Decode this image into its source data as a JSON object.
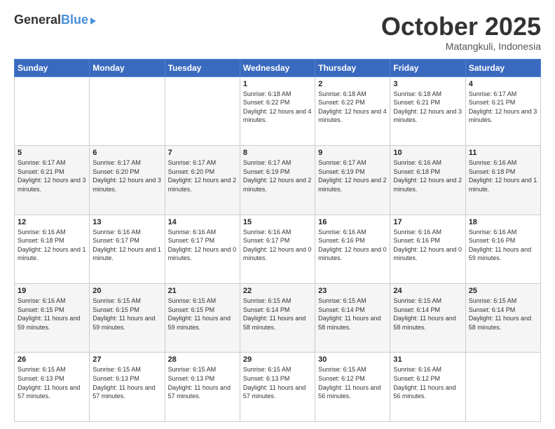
{
  "logo": {
    "general": "General",
    "blue": "Blue"
  },
  "header": {
    "month": "October 2025",
    "location": "Matangkuli, Indonesia"
  },
  "days_of_week": [
    "Sunday",
    "Monday",
    "Tuesday",
    "Wednesday",
    "Thursday",
    "Friday",
    "Saturday"
  ],
  "weeks": [
    [
      {
        "day": "",
        "sunrise": "",
        "sunset": "",
        "daylight": ""
      },
      {
        "day": "",
        "sunrise": "",
        "sunset": "",
        "daylight": ""
      },
      {
        "day": "",
        "sunrise": "",
        "sunset": "",
        "daylight": ""
      },
      {
        "day": "1",
        "sunrise": "Sunrise: 6:18 AM",
        "sunset": "Sunset: 6:22 PM",
        "daylight": "Daylight: 12 hours and 4 minutes."
      },
      {
        "day": "2",
        "sunrise": "Sunrise: 6:18 AM",
        "sunset": "Sunset: 6:22 PM",
        "daylight": "Daylight: 12 hours and 4 minutes."
      },
      {
        "day": "3",
        "sunrise": "Sunrise: 6:18 AM",
        "sunset": "Sunset: 6:21 PM",
        "daylight": "Daylight: 12 hours and 3 minutes."
      },
      {
        "day": "4",
        "sunrise": "Sunrise: 6:17 AM",
        "sunset": "Sunset: 6:21 PM",
        "daylight": "Daylight: 12 hours and 3 minutes."
      }
    ],
    [
      {
        "day": "5",
        "sunrise": "Sunrise: 6:17 AM",
        "sunset": "Sunset: 6:21 PM",
        "daylight": "Daylight: 12 hours and 3 minutes."
      },
      {
        "day": "6",
        "sunrise": "Sunrise: 6:17 AM",
        "sunset": "Sunset: 6:20 PM",
        "daylight": "Daylight: 12 hours and 3 minutes."
      },
      {
        "day": "7",
        "sunrise": "Sunrise: 6:17 AM",
        "sunset": "Sunset: 6:20 PM",
        "daylight": "Daylight: 12 hours and 2 minutes."
      },
      {
        "day": "8",
        "sunrise": "Sunrise: 6:17 AM",
        "sunset": "Sunset: 6:19 PM",
        "daylight": "Daylight: 12 hours and 2 minutes."
      },
      {
        "day": "9",
        "sunrise": "Sunrise: 6:17 AM",
        "sunset": "Sunset: 6:19 PM",
        "daylight": "Daylight: 12 hours and 2 minutes."
      },
      {
        "day": "10",
        "sunrise": "Sunrise: 6:16 AM",
        "sunset": "Sunset: 6:18 PM",
        "daylight": "Daylight: 12 hours and 2 minutes."
      },
      {
        "day": "11",
        "sunrise": "Sunrise: 6:16 AM",
        "sunset": "Sunset: 6:18 PM",
        "daylight": "Daylight: 12 hours and 1 minute."
      }
    ],
    [
      {
        "day": "12",
        "sunrise": "Sunrise: 6:16 AM",
        "sunset": "Sunset: 6:18 PM",
        "daylight": "Daylight: 12 hours and 1 minute."
      },
      {
        "day": "13",
        "sunrise": "Sunrise: 6:16 AM",
        "sunset": "Sunset: 6:17 PM",
        "daylight": "Daylight: 12 hours and 1 minute."
      },
      {
        "day": "14",
        "sunrise": "Sunrise: 6:16 AM",
        "sunset": "Sunset: 6:17 PM",
        "daylight": "Daylight: 12 hours and 0 minutes."
      },
      {
        "day": "15",
        "sunrise": "Sunrise: 6:16 AM",
        "sunset": "Sunset: 6:17 PM",
        "daylight": "Daylight: 12 hours and 0 minutes."
      },
      {
        "day": "16",
        "sunrise": "Sunrise: 6:16 AM",
        "sunset": "Sunset: 6:16 PM",
        "daylight": "Daylight: 12 hours and 0 minutes."
      },
      {
        "day": "17",
        "sunrise": "Sunrise: 6:16 AM",
        "sunset": "Sunset: 6:16 PM",
        "daylight": "Daylight: 12 hours and 0 minutes."
      },
      {
        "day": "18",
        "sunrise": "Sunrise: 6:16 AM",
        "sunset": "Sunset: 6:16 PM",
        "daylight": "Daylight: 11 hours and 59 minutes."
      }
    ],
    [
      {
        "day": "19",
        "sunrise": "Sunrise: 6:16 AM",
        "sunset": "Sunset: 6:15 PM",
        "daylight": "Daylight: 11 hours and 59 minutes."
      },
      {
        "day": "20",
        "sunrise": "Sunrise: 6:15 AM",
        "sunset": "Sunset: 6:15 PM",
        "daylight": "Daylight: 11 hours and 59 minutes."
      },
      {
        "day": "21",
        "sunrise": "Sunrise: 6:15 AM",
        "sunset": "Sunset: 6:15 PM",
        "daylight": "Daylight: 11 hours and 59 minutes."
      },
      {
        "day": "22",
        "sunrise": "Sunrise: 6:15 AM",
        "sunset": "Sunset: 6:14 PM",
        "daylight": "Daylight: 11 hours and 58 minutes."
      },
      {
        "day": "23",
        "sunrise": "Sunrise: 6:15 AM",
        "sunset": "Sunset: 6:14 PM",
        "daylight": "Daylight: 11 hours and 58 minutes."
      },
      {
        "day": "24",
        "sunrise": "Sunrise: 6:15 AM",
        "sunset": "Sunset: 6:14 PM",
        "daylight": "Daylight: 11 hours and 58 minutes."
      },
      {
        "day": "25",
        "sunrise": "Sunrise: 6:15 AM",
        "sunset": "Sunset: 6:14 PM",
        "daylight": "Daylight: 11 hours and 58 minutes."
      }
    ],
    [
      {
        "day": "26",
        "sunrise": "Sunrise: 6:15 AM",
        "sunset": "Sunset: 6:13 PM",
        "daylight": "Daylight: 11 hours and 57 minutes."
      },
      {
        "day": "27",
        "sunrise": "Sunrise: 6:15 AM",
        "sunset": "Sunset: 6:13 PM",
        "daylight": "Daylight: 11 hours and 57 minutes."
      },
      {
        "day": "28",
        "sunrise": "Sunrise: 6:15 AM",
        "sunset": "Sunset: 6:13 PM",
        "daylight": "Daylight: 11 hours and 57 minutes."
      },
      {
        "day": "29",
        "sunrise": "Sunrise: 6:15 AM",
        "sunset": "Sunset: 6:13 PM",
        "daylight": "Daylight: 11 hours and 57 minutes."
      },
      {
        "day": "30",
        "sunrise": "Sunrise: 6:15 AM",
        "sunset": "Sunset: 6:12 PM",
        "daylight": "Daylight: 11 hours and 56 minutes."
      },
      {
        "day": "31",
        "sunrise": "Sunrise: 6:16 AM",
        "sunset": "Sunset: 6:12 PM",
        "daylight": "Daylight: 11 hours and 56 minutes."
      },
      {
        "day": "",
        "sunrise": "",
        "sunset": "",
        "daylight": ""
      }
    ]
  ]
}
